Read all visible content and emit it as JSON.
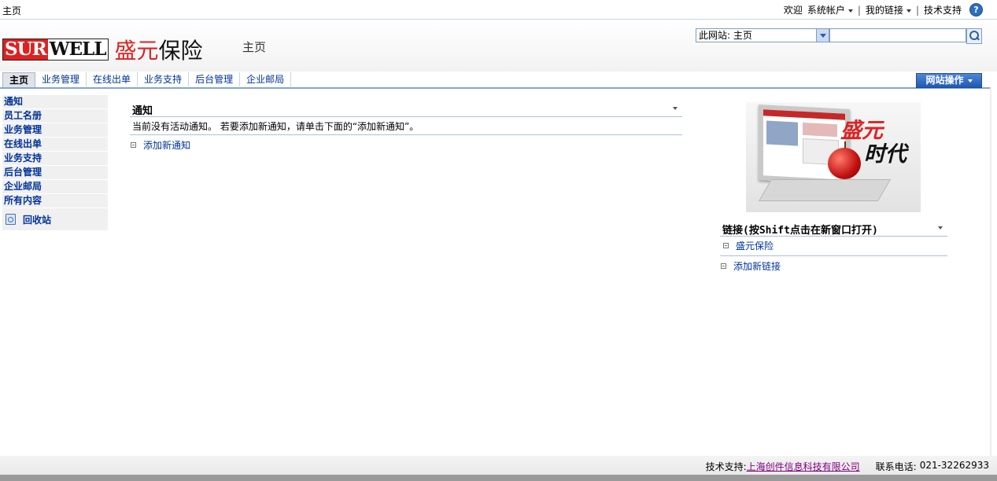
{
  "topbar": {
    "breadcrumb": "主页",
    "welcome": "欢迎",
    "account": "系统帐户",
    "my_links": "我的链接",
    "support": "技术支持",
    "help_glyph": "?"
  },
  "header": {
    "logo_sur": "SUR",
    "logo_well": "WELL",
    "logo_cn_red": "盛元",
    "logo_cn_black": "保险",
    "page_title": "主页",
    "search_scope": "此网站: 主页",
    "search_value": ""
  },
  "nav": {
    "tabs": [
      "主页",
      "业务管理",
      "在线出单",
      "业务支持",
      "后台管理",
      "企业邮局"
    ],
    "site_actions": "网站操作"
  },
  "quicklaunch": {
    "items": [
      "通知",
      "员工名册",
      "业务管理",
      "在线出单",
      "业务支持",
      "后台管理",
      "企业邮局",
      "所有内容"
    ],
    "recycle": "回收站"
  },
  "announcements": {
    "title": "通知",
    "empty_text": "当前没有活动通知。 若要添加新通知，请单击下面的“添加新通知”。",
    "add_link": "添加新通知"
  },
  "promo": {
    "line1": "盛元",
    "line2": "时代"
  },
  "links": {
    "title": "链接(按Shift点击在新窗口打开)",
    "items": [
      "盛元保险"
    ],
    "add_link": "添加新链接"
  },
  "footer": {
    "support_label": "技术支持:",
    "company": "上海创件信息科技有限公司",
    "phone_label": "联系电话:",
    "phone": "021-32262933"
  }
}
